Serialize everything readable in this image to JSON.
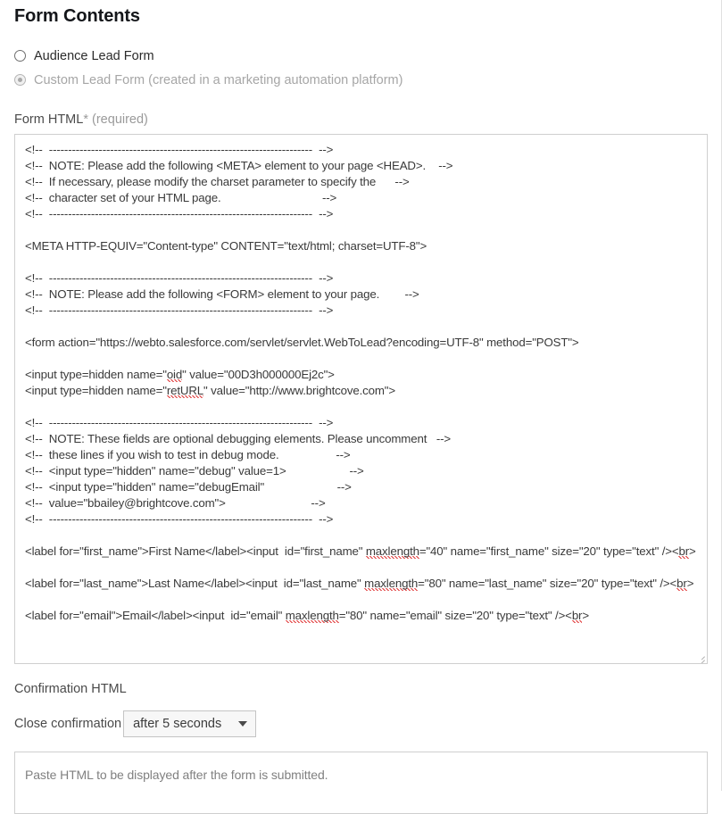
{
  "section": {
    "title": "Form Contents"
  },
  "form_type": {
    "options": [
      {
        "label": "Audience Lead Form",
        "selected": false,
        "disabled": false,
        "icon": "radio-unchecked-icon"
      },
      {
        "label": "Custom Lead Form (created in a marketing automation platform)",
        "selected": true,
        "disabled": true,
        "icon": "radio-checked-icon"
      }
    ]
  },
  "form_html": {
    "label_main": "Form HTML",
    "label_asterisk": "*",
    "label_required": " (required)",
    "value": "<!--  ---------------------------------------------------------------------  -->\n<!--  NOTE: Please add the following <META> element to your page <HEAD>.    -->\n<!--  If necessary, please modify the charset parameter to specify the      -->\n<!--  character set of your HTML page.                                -->\n<!--  ---------------------------------------------------------------------  -->\n\n<META HTTP-EQUIV=\"Content-type\" CONTENT=\"text/html; charset=UTF-8\">\n\n<!--  ---------------------------------------------------------------------  -->\n<!--  NOTE: Please add the following <FORM> element to your page.        -->\n<!--  ---------------------------------------------------------------------  -->\n\n<form action=\"https://webto.salesforce.com/servlet/servlet.WebToLead?encoding=UTF-8\" method=\"POST\">\n\n<input type=hidden name=\"oid\" value=\"00D3h000000Ej2c\">\n<input type=hidden name=\"retURL\" value=\"http://www.brightcove.com\">\n\n<!--  ---------------------------------------------------------------------  -->\n<!--  NOTE: These fields are optional debugging elements. Please uncomment   -->\n<!--  these lines if you wish to test in debug mode.                  -->\n<!--  <input type=\"hidden\" name=\"debug\" value=1>                    -->\n<!--  <input type=\"hidden\" name=\"debugEmail\"                       -->\n<!--  value=\"bbailey@brightcove.com\">                           -->\n<!--  ---------------------------------------------------------------------  -->\n\n<label for=\"first_name\">First Name</label><input  id=\"first_name\" maxlength=\"40\" name=\"first_name\" size=\"20\" type=\"text\" /><br>\n\n<label for=\"last_name\">Last Name</label><input  id=\"last_name\" maxlength=\"80\" name=\"last_name\" size=\"20\" type=\"text\" /><br>\n\n<label for=\"email\">Email</label><input  id=\"email\" maxlength=\"80\" name=\"email\" size=\"20\" type=\"text\" /><br>",
    "resize_handle": "resize-grip-icon"
  },
  "confirmation": {
    "label": "Confirmation HTML",
    "close_label": "Close confirmation",
    "close_selected": "after 5 seconds",
    "caret_icon": "chevron-down-icon",
    "placeholder": "Paste HTML to be displayed after the form is submitted.",
    "value": ""
  },
  "colors": {
    "text_dark": "#14161a",
    "text_body": "#3a3a3a",
    "text_label": "#4a4a4a",
    "text_muted": "#9a9a9a",
    "text_disabled": "#a6a6a6",
    "border": "#cfcfcf",
    "select_bg": "#f7f7f7",
    "spellcheck": "#e03b3b"
  }
}
